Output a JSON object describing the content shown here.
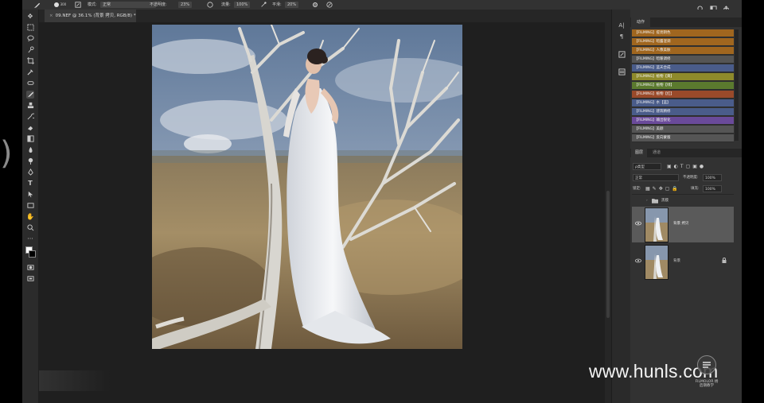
{
  "options_bar": {
    "brush_size": "300",
    "mode_label": "模式:",
    "mode_value": "正常",
    "opacity_label": "不透明度:",
    "opacity_value": "23%",
    "flow_label": "流量:",
    "flow_value": "100%",
    "smoothing_label": "平滑:",
    "smoothing_value": "20%"
  },
  "document_tab": {
    "title": "09.NEF @ 36.1% (背景 拷贝, RGB/8) *"
  },
  "panels": {
    "actions_tab": "动作",
    "actions": [
      {
        "label": "【FILMING】提亮阴色",
        "color": "#a0661f"
      },
      {
        "label": "【FILMING】暗露混调",
        "color": "#a0661f"
      },
      {
        "label": "【FILMING】人像美肤",
        "color": "#a0661f"
      },
      {
        "label": "【FILMING】暗暖调修",
        "color": "#555555"
      },
      {
        "label": "【FILMING】蓝天合成",
        "color": "#4a5c8a"
      },
      {
        "label": "【FILMING】植物【黄】",
        "color": "#8e8a2b"
      },
      {
        "label": "【FILMING】植物【绿】",
        "color": "#5b7a2e"
      },
      {
        "label": "【FILMING】植物【红】",
        "color": "#9a4a2a"
      },
      {
        "label": "【FILMING】水【蓝】",
        "color": "#4a5c8a"
      },
      {
        "label": "【FILMING】建筑精修",
        "color": "#4a5c8a"
      },
      {
        "label": "【FILMING】输出锐化",
        "color": "#6a4a9a"
      },
      {
        "label": "【FILMING】美颜",
        "color": "#555555"
      },
      {
        "label": "【FILMING】反向蒙版",
        "color": "#555555"
      }
    ],
    "layers_tab": "图层",
    "channels_tab": "通道",
    "filter_kind": "ρ类型",
    "blend_mode": "正常",
    "opacity_label": "不透明度:",
    "opacity_value": "100%",
    "lock_label": "锁定:",
    "fill_label": "填充:",
    "fill_value": "100%",
    "layers": [
      {
        "name": "黑膜",
        "type": "group"
      },
      {
        "name": "背景 拷贝",
        "type": "pixel",
        "selected": true
      },
      {
        "name": "背景",
        "type": "pixel",
        "locked": true
      }
    ]
  },
  "watermark": {
    "text": "www.hunls.com",
    "badge_line1": "FILMOLOR 杨",
    "badge_line2": "后期教学"
  },
  "icons": [
    "brush-icon",
    "search-icon",
    "window-icon",
    "share-icon",
    "eye-icon",
    "lock-icon",
    "folder-icon"
  ]
}
